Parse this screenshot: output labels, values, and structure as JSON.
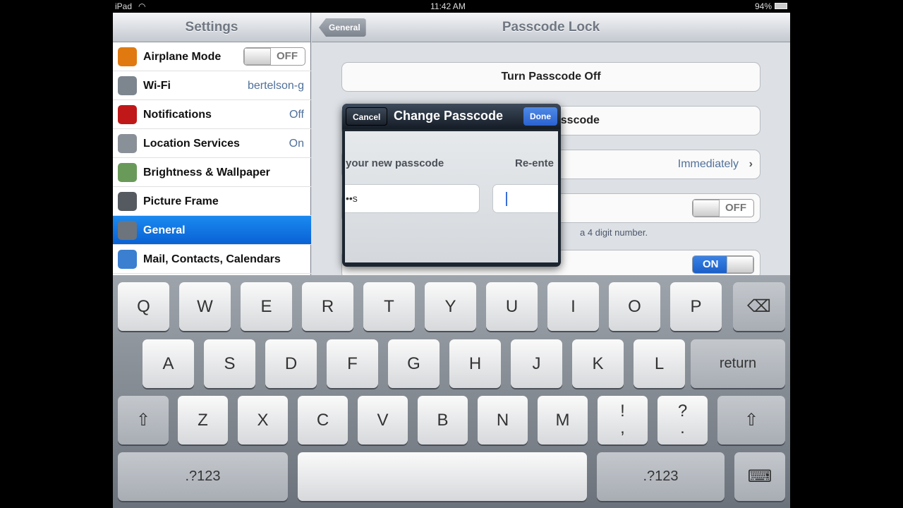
{
  "status": {
    "device": "iPad",
    "time": "11:42 AM",
    "battery": "94%"
  },
  "left_nav": {
    "title": "Settings"
  },
  "right_nav": {
    "back": "General",
    "title": "Passcode Lock"
  },
  "sidebar": {
    "items": [
      {
        "label": "Airplane Mode",
        "toggle": "OFF",
        "icon": "airplane-icon",
        "color": "#e07a10"
      },
      {
        "label": "Wi-Fi",
        "value": "bertelson-g",
        "icon": "wifi-icon",
        "color": "#7d858e"
      },
      {
        "label": "Notifications",
        "value": "Off",
        "icon": "notifications-icon",
        "color": "#c01818"
      },
      {
        "label": "Location Services",
        "value": "On",
        "icon": "location-icon",
        "color": "#8a9098"
      },
      {
        "label": "Brightness & Wallpaper",
        "icon": "brightness-icon",
        "color": "#6a9a5a"
      },
      {
        "label": "Picture Frame",
        "icon": "picture-frame-icon",
        "color": "#555a60"
      },
      {
        "label": "General",
        "icon": "gear-icon",
        "color": "#6d747c",
        "selected": true
      },
      {
        "label": "Mail, Contacts, Calendars",
        "icon": "mail-icon",
        "color": "#3a7fd0"
      }
    ]
  },
  "main": {
    "turn_off": "Turn Passcode Off",
    "change": "Change Passcode",
    "require_value": "Immediately",
    "simple_toggle": "OFF",
    "footnote": "a 4 digit number.",
    "picture_frame_toggle": "ON"
  },
  "modal": {
    "cancel": "Cancel",
    "title": "Change Passcode",
    "done": "Done",
    "label1": "your new passcode",
    "label2": "Re-ente",
    "field1_value": "••s"
  },
  "keyboard": {
    "rows": [
      [
        "Q",
        "W",
        "E",
        "R",
        "T",
        "Y",
        "U",
        "I",
        "O",
        "P",
        "⌫"
      ],
      [
        "A",
        "S",
        "D",
        "F",
        "G",
        "H",
        "J",
        "K",
        "L",
        "return"
      ],
      [
        "⇧",
        "Z",
        "X",
        "C",
        "V",
        "B",
        "N",
        "M",
        "!\n,",
        "?\n.",
        "⇧"
      ],
      [
        ".?123",
        " ",
        ".?123",
        "⌨"
      ]
    ]
  },
  "colors": {
    "accent": "#0a62d4",
    "done": "#2f6fd6"
  }
}
